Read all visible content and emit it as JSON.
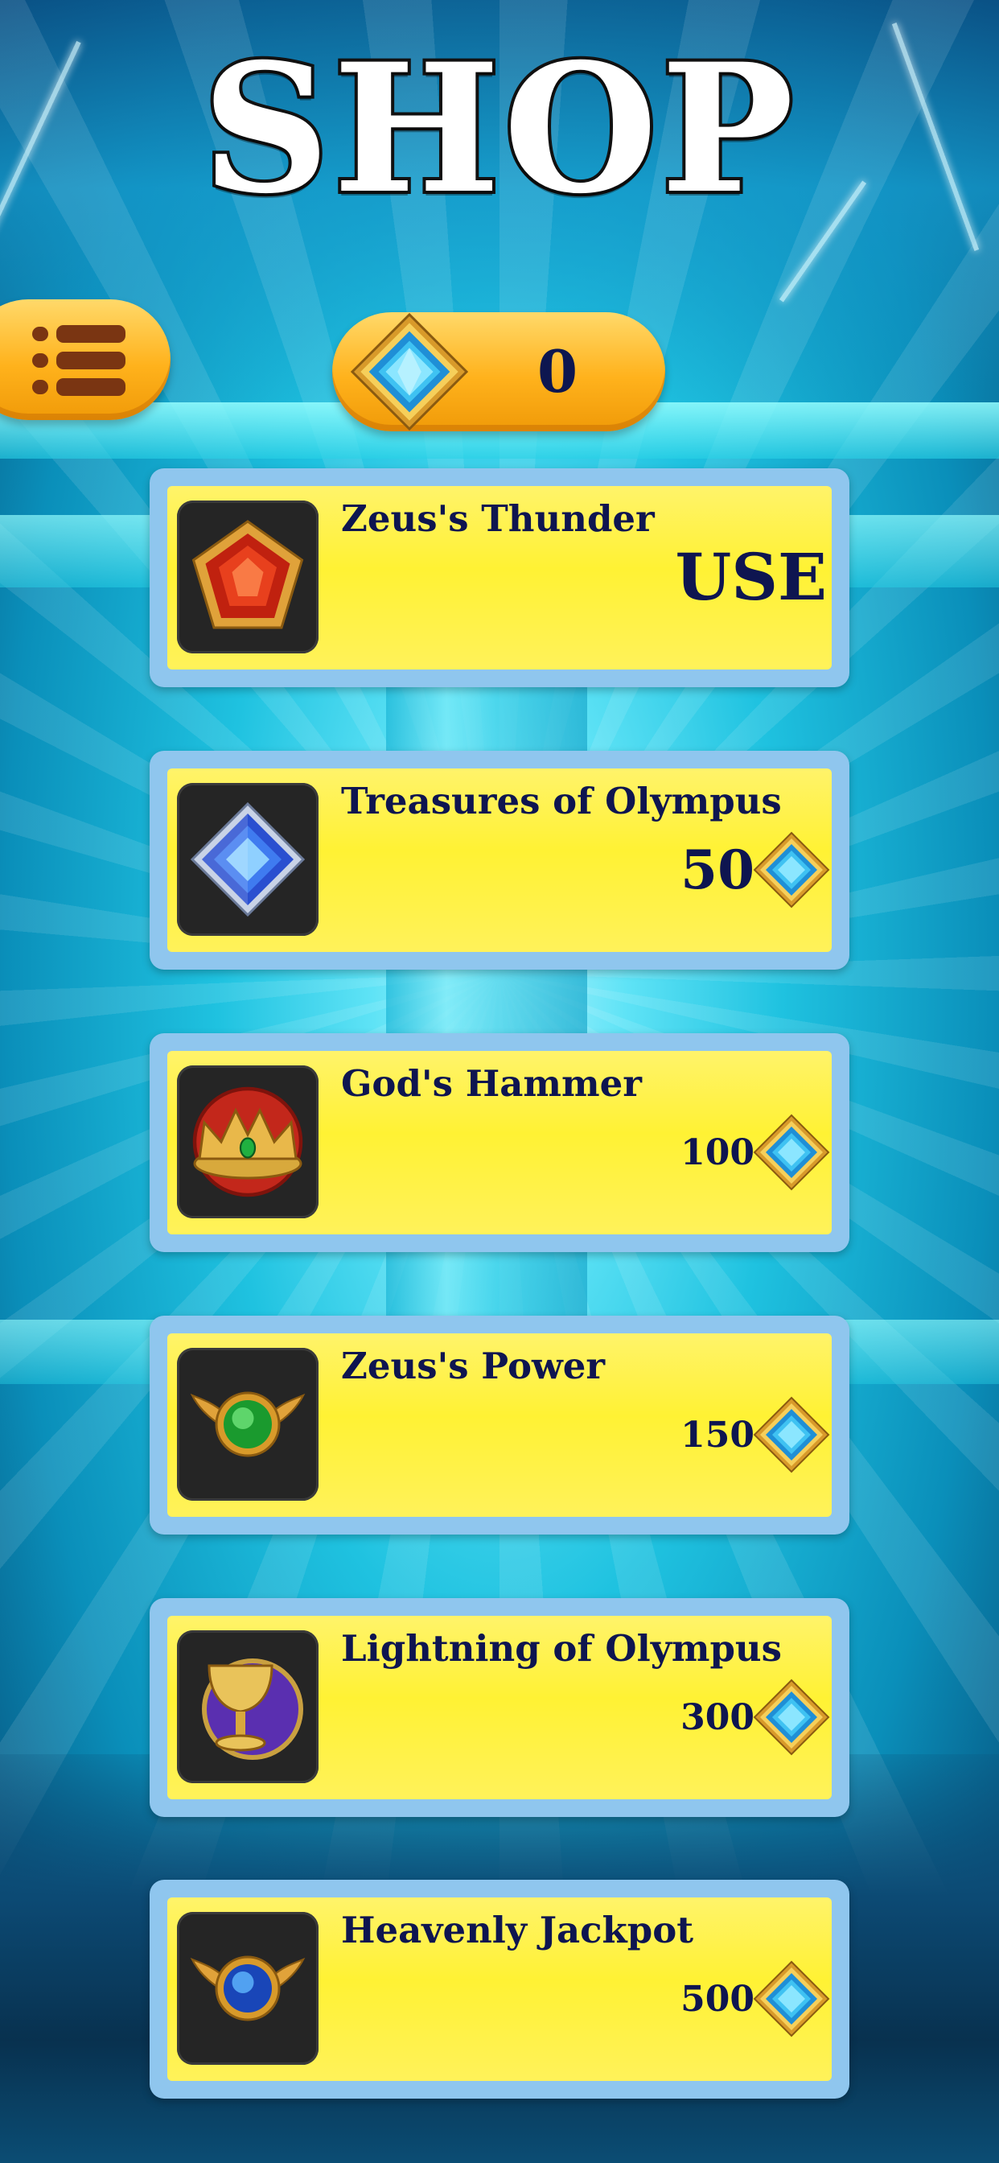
{
  "title": "SHOP",
  "menu": {
    "icon": "list-menu-icon"
  },
  "currency": {
    "icon": "blue-gem-icon",
    "value": "0"
  },
  "items": [
    {
      "name": "Zeus's Thunder",
      "icon": "red-gem-icon",
      "action": "USE",
      "price": null
    },
    {
      "name": "Treasures of Olympus",
      "icon": "blue-diamond-icon",
      "action": null,
      "price": "50"
    },
    {
      "name": "God's Hammer",
      "icon": "golden-crown-icon",
      "action": null,
      "price": "100"
    },
    {
      "name": "Zeus's Power",
      "icon": "green-orb-wings-icon",
      "action": null,
      "price": "150"
    },
    {
      "name": "Lightning of Olympus",
      "icon": "golden-chalice-icon",
      "action": null,
      "price": "300"
    },
    {
      "name": "Heavenly Jackpot",
      "icon": "blue-orb-wings-icon",
      "action": null,
      "price": "500"
    }
  ],
  "colors": {
    "panel_yellow": "#fff234",
    "panel_border": "#8fc6ee",
    "text_navy": "#0e1550",
    "button_orange": "#ffb21c"
  }
}
